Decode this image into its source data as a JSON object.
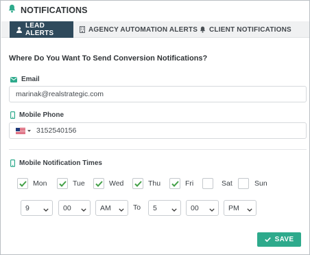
{
  "header": {
    "title": "NOTIFICATIONS",
    "icon": "bell-icon"
  },
  "tabs": [
    {
      "label": "LEAD ALERTS",
      "icon": "user-icon",
      "active": true
    },
    {
      "label": "AGENCY AUTOMATION ALERTS",
      "icon": "building-icon",
      "active": false
    },
    {
      "label": "CLIENT NOTIFICATIONS",
      "icon": "bell-icon",
      "active": false
    }
  ],
  "form": {
    "heading": "Where Do You Want To Send Conversion Notifications?",
    "email": {
      "label": "Email",
      "icon": "envelope-icon",
      "value": "marinak@realstrategic.com"
    },
    "phone": {
      "label": "Mobile Phone",
      "icon": "mobile-icon",
      "country_flag": "us-flag-icon",
      "value": "3152540156"
    },
    "times": {
      "label": "Mobile Notification Times",
      "icon": "mobile-icon",
      "days": [
        {
          "label": "Mon",
          "checked": true
        },
        {
          "label": "Tue",
          "checked": true
        },
        {
          "label": "Wed",
          "checked": true
        },
        {
          "label": "Thu",
          "checked": true
        },
        {
          "label": "Fri",
          "checked": true
        },
        {
          "label": "Sat",
          "checked": false
        },
        {
          "label": "Sun",
          "checked": false
        }
      ],
      "from_hour": "9",
      "from_minute": "00",
      "from_ampm": "AM",
      "to_label": "To",
      "to_hour": "5",
      "to_minute": "00",
      "to_ampm": "PM"
    }
  },
  "save_button": {
    "label": "SAVE",
    "icon": "check-icon"
  },
  "colors": {
    "accent_green": "#2eaa8c",
    "tab_active": "#2f4a5c",
    "check_green": "#43a047"
  }
}
